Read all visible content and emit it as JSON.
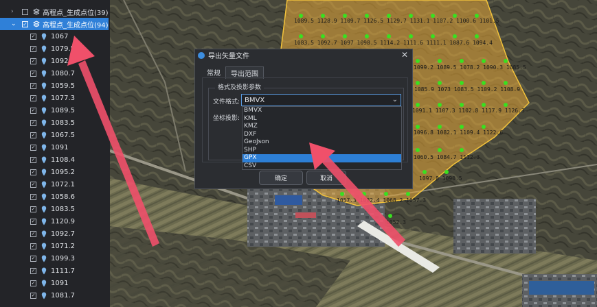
{
  "tree": {
    "group1": {
      "name": "高程点_生成点位(39)",
      "expanded": false
    },
    "group2": {
      "name": "高程点_生成点位(94)",
      "expanded": true
    },
    "items": [
      "1067",
      "1079.5",
      "1092.9",
      "1080.7",
      "1059.5",
      "1077.3",
      "1089.5",
      "1083.5",
      "1067.5",
      "1091",
      "1108.4",
      "1095.2",
      "1072.1",
      "1058.6",
      "1083.5",
      "1120.9",
      "1092.7",
      "1071.2",
      "1099.3",
      "1111.7",
      "1091",
      "1081.7"
    ]
  },
  "map": {
    "polygon_color": "#e6a838",
    "point_color": "#39e020",
    "labels": [
      {
        "text": "1089.5 1128.9 1109.7 1126.5 1129.7 1131.1 1107.2 1100.6 1101.5"
      },
      {
        "text": "1083.5 1092.7  1097 1098.5 1114.2 1111.6 1111.1 1087.6 1094.4"
      },
      {
        "text": "1099.2 1089.5 1078.2 1090.3 1085.5"
      },
      {
        "text": "1085.9  1073 1083.5 1109.2 1108.9"
      },
      {
        "text": "1091.1 1107.3 1102.8 1117.9 1126.3"
      },
      {
        "text": "1096.8 1082.1 1109.4 1122.6"
      },
      {
        "text": "1060.5 1084.7 1112.3"
      },
      {
        "text": "1097.8 1090.5"
      },
      {
        "text": "1057.3 1082.4 1068.2 1057.3"
      },
      {
        "text": "1052.3"
      }
    ]
  },
  "dialog": {
    "title": "导出矢量文件",
    "close": "✕",
    "tabs": [
      "常规",
      "导出范围"
    ],
    "legend": "格式及投影参数",
    "format_label": "文件格式:",
    "projection_label": "坐标投影:",
    "format_value": "BMVX",
    "ok": "确定",
    "cancel": "取消"
  },
  "dropdown": {
    "options": [
      "BMVX",
      "KML",
      "KMZ",
      "DXF",
      "GeoJson",
      "SHP",
      "GPX",
      "CSV"
    ],
    "highlighted": "GPX"
  },
  "colors": {
    "accent": "#2d7fd6",
    "arrow": "#f0506a"
  }
}
